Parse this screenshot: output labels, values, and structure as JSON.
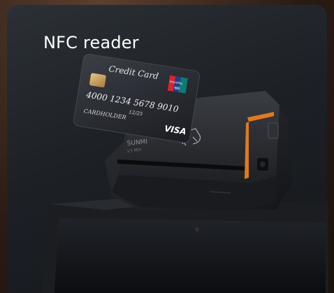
{
  "panel": {
    "title": "NFC reader"
  },
  "credit_card": {
    "label": "Credit Card",
    "number": "4000 1234 5678 9010",
    "expiry": "12/25",
    "holder": "CARDHOLDER",
    "network": "VISA",
    "badge_text": "UnionPay",
    "badge_sub": "银联"
  },
  "device": {
    "brand": "SUNMI",
    "model": "V3 MIX",
    "nfc_symbol": "contactless-tap-icon"
  },
  "colors": {
    "accent": "#e07a1c",
    "panel_bg": "#1d2126"
  }
}
